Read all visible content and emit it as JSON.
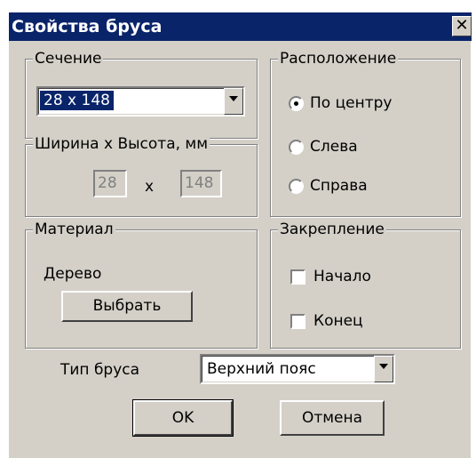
{
  "window": {
    "title": "Свойства бруса",
    "close_glyph": "✕"
  },
  "section": {
    "legend": "Сечение",
    "selected_value": "28 x 148"
  },
  "dimensions": {
    "legend": "Ширина x Высота, мм",
    "width": "28",
    "separator": "x",
    "height": "148"
  },
  "placement": {
    "legend": "Расположение",
    "options": [
      {
        "label": "По центру",
        "checked": true
      },
      {
        "label": "Слева",
        "checked": false
      },
      {
        "label": "Справа",
        "checked": false
      }
    ]
  },
  "material": {
    "legend": "Материал",
    "value": "Дерево",
    "choose_button": "Выбрать"
  },
  "fixing": {
    "legend": "Закрепление",
    "options": [
      {
        "label": "Начало",
        "checked": false
      },
      {
        "label": "Конец",
        "checked": false
      }
    ]
  },
  "beam_type": {
    "label": "Тип бруса",
    "selected_value": "Верхний пояс"
  },
  "buttons": {
    "ok": "OK",
    "cancel": "Отмена"
  },
  "colors": {
    "titlebar": "#0a246a",
    "face": "#d4d0c8",
    "selection": "#0a246a"
  }
}
